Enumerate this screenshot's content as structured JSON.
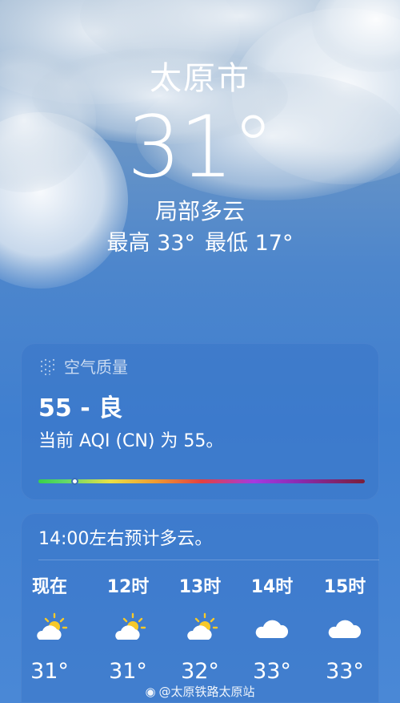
{
  "header": {
    "city": "太原市",
    "temperature": "31°",
    "condition": "局部多云",
    "high": "最高 33°",
    "low": "最低 17°"
  },
  "aqi": {
    "title": "空气质量",
    "value_label": "55 - 良",
    "description": "当前 AQI (CN) 为 55。",
    "scale_position": 0.11,
    "colors": [
      "#38d14a",
      "#e9e146",
      "#ee9a33",
      "#e24040",
      "#a43ae0",
      "#7a1f3a"
    ]
  },
  "forecast": {
    "summary": "14:00左右预计多云。",
    "hours": [
      {
        "time": "现在",
        "icon": "partly-sunny-icon",
        "temp": "31°"
      },
      {
        "time": "12时",
        "icon": "partly-sunny-icon",
        "temp": "31°"
      },
      {
        "time": "13时",
        "icon": "partly-sunny-icon",
        "temp": "32°"
      },
      {
        "time": "14时",
        "icon": "cloud-icon",
        "temp": "33°"
      },
      {
        "time": "15时",
        "icon": "cloud-icon",
        "temp": "33°"
      }
    ]
  },
  "watermark": {
    "text": "@太原铁路太原站"
  }
}
